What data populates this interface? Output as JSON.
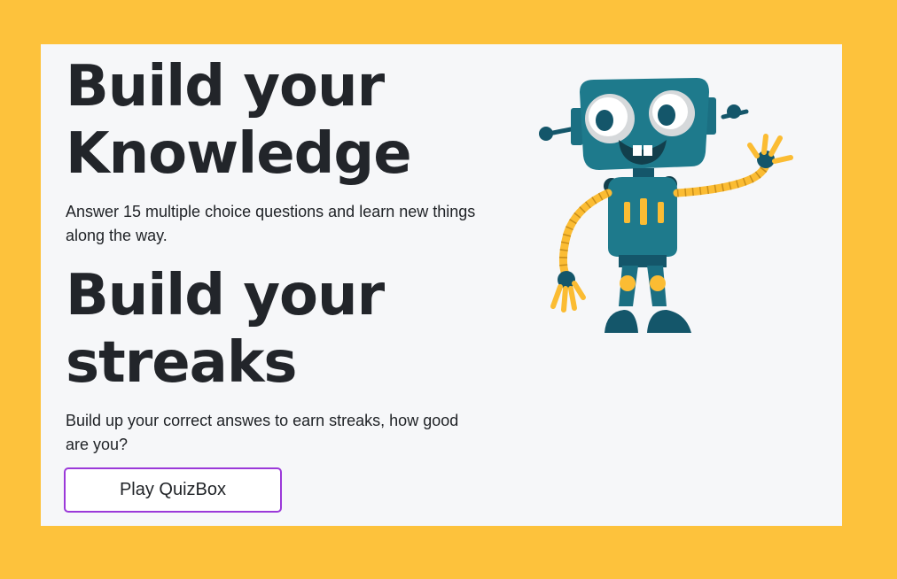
{
  "hero": {
    "section1": {
      "title_line1": "Build your",
      "title_line2": "Knowledge",
      "description": "Answer 15 multiple choice questions and learn new things along the way."
    },
    "section2": {
      "title_line1": "Build your",
      "title_line2": "streaks",
      "description": "Build up your correct answes to earn streaks, how good are you?"
    },
    "cta_label": "Play QuizBox"
  },
  "illustration": {
    "icon": "robot-mascot-icon"
  },
  "colors": {
    "page_background": "#fdc23c",
    "card_background": "#f6f7f9",
    "heading_text": "#22252a",
    "button_border": "#9b39d9",
    "robot_body": "#1e7a8c",
    "robot_dark": "#14566a",
    "robot_accent": "#fbbc33"
  }
}
